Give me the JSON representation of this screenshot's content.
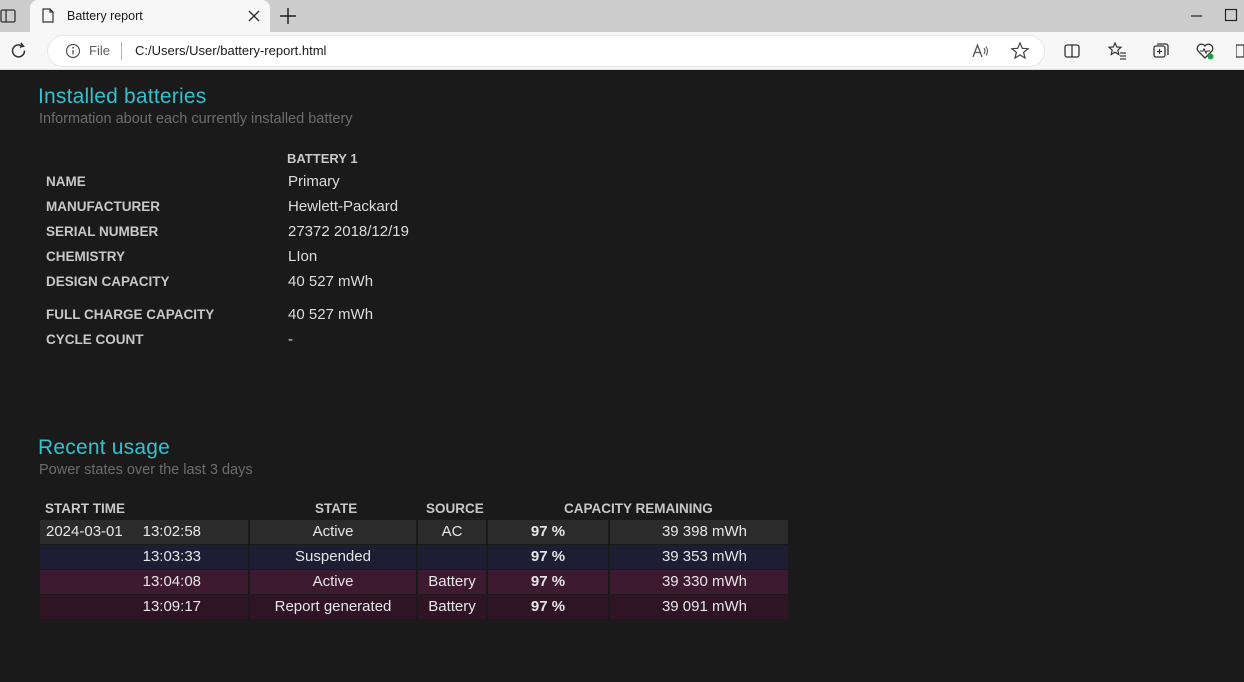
{
  "browser": {
    "tab_title": "Battery report",
    "address_scheme_label": "File",
    "url": "C:/Users/User/battery-report.html"
  },
  "installed": {
    "heading": "Installed batteries",
    "subtitle": "Information about each currently installed battery",
    "column_header": "BATTERY 1",
    "rows": [
      {
        "label": "NAME",
        "value": "Primary"
      },
      {
        "label": "MANUFACTURER",
        "value": "Hewlett-Packard"
      },
      {
        "label": "SERIAL NUMBER",
        "value": "27372 2018/12/19"
      },
      {
        "label": "CHEMISTRY",
        "value": "LIon"
      },
      {
        "label": "DESIGN CAPACITY",
        "value": "40 527 mWh"
      },
      {
        "label": "FULL CHARGE CAPACITY",
        "value": "40 527 mWh"
      },
      {
        "label": "CYCLE COUNT",
        "value": "-"
      }
    ]
  },
  "usage": {
    "heading": "Recent usage",
    "subtitle": "Power states over the last 3 days",
    "headers": {
      "start_time": "START TIME",
      "state": "STATE",
      "source": "SOURCE",
      "capacity": "CAPACITY REMAINING"
    },
    "rows": [
      {
        "date": "2024-03-01",
        "time": "13:02:58",
        "state": "Active",
        "source": "AC",
        "percent": "97 %",
        "mwh": "39 398 mWh",
        "bg": "#2b2b2b"
      },
      {
        "date": "",
        "time": "13:03:33",
        "state": "Suspended",
        "source": "",
        "percent": "97 %",
        "mwh": "39 353 mWh",
        "bg": "#1d1e33"
      },
      {
        "date": "",
        "time": "13:04:08",
        "state": "Active",
        "source": "Battery",
        "percent": "97 %",
        "mwh": "39 330 mWh",
        "bg": "#3e1a30"
      },
      {
        "date": "",
        "time": "13:09:17",
        "state": "Report generated",
        "source": "Battery",
        "percent": "97 %",
        "mwh": "39 091 mWh",
        "bg": "#2f1424"
      }
    ]
  }
}
